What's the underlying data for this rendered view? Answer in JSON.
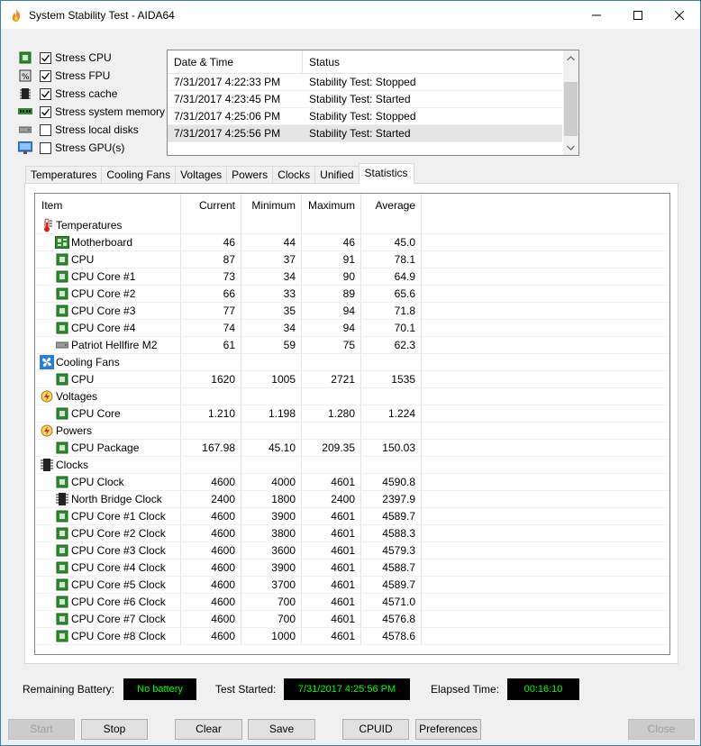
{
  "window": {
    "title": "System Stability Test - AIDA64"
  },
  "stress": [
    {
      "label": "Stress CPU",
      "checked": true,
      "icon": "cpu-chip-icon"
    },
    {
      "label": "Stress FPU",
      "checked": true,
      "icon": "fpu-icon"
    },
    {
      "label": "Stress cache",
      "checked": true,
      "icon": "cache-icon"
    },
    {
      "label": "Stress system memory",
      "checked": true,
      "icon": "memory-icon"
    },
    {
      "label": "Stress local disks",
      "checked": false,
      "icon": "disk-icon"
    },
    {
      "label": "Stress GPU(s)",
      "checked": false,
      "icon": "monitor-icon"
    }
  ],
  "log": {
    "headers": [
      "Date & Time",
      "Status"
    ],
    "rows": [
      {
        "time": "7/31/2017 4:22:33 PM",
        "status": "Stability Test: Stopped"
      },
      {
        "time": "7/31/2017 4:23:45 PM",
        "status": "Stability Test: Started"
      },
      {
        "time": "7/31/2017 4:25:06 PM",
        "status": "Stability Test: Stopped"
      },
      {
        "time": "7/31/2017 4:25:56 PM",
        "status": "Stability Test: Started"
      }
    ]
  },
  "tabs": [
    "Temperatures",
    "Cooling Fans",
    "Voltages",
    "Powers",
    "Clocks",
    "Unified",
    "Statistics"
  ],
  "active_tab": "Statistics",
  "stats": {
    "headers": {
      "item": "Item",
      "current": "Current",
      "minimum": "Minimum",
      "maximum": "Maximum",
      "average": "Average"
    },
    "rows": [
      {
        "type": "group",
        "icon": "thermometer-icon",
        "item": "Temperatures"
      },
      {
        "type": "child",
        "icon": "motherboard-icon",
        "item": "Motherboard",
        "current": "46",
        "minimum": "44",
        "maximum": "46",
        "average": "45.0"
      },
      {
        "type": "child",
        "icon": "cpu-chip-icon",
        "item": "CPU",
        "current": "87",
        "minimum": "37",
        "maximum": "91",
        "average": "78.1"
      },
      {
        "type": "child",
        "icon": "cpu-chip-icon",
        "item": "CPU Core #1",
        "current": "73",
        "minimum": "34",
        "maximum": "90",
        "average": "64.9"
      },
      {
        "type": "child",
        "icon": "cpu-chip-icon",
        "item": "CPU Core #2",
        "current": "66",
        "minimum": "33",
        "maximum": "89",
        "average": "65.6"
      },
      {
        "type": "child",
        "icon": "cpu-chip-icon",
        "item": "CPU Core #3",
        "current": "77",
        "minimum": "35",
        "maximum": "94",
        "average": "71.8"
      },
      {
        "type": "child",
        "icon": "cpu-chip-icon",
        "item": "CPU Core #4",
        "current": "74",
        "minimum": "34",
        "maximum": "94",
        "average": "70.1"
      },
      {
        "type": "child",
        "icon": "ssd-icon",
        "item": "Patriot Hellfire M2",
        "current": "61",
        "minimum": "59",
        "maximum": "75",
        "average": "62.3"
      },
      {
        "type": "group",
        "icon": "fan-icon",
        "item": "Cooling Fans"
      },
      {
        "type": "child",
        "icon": "cpu-chip-icon",
        "item": "CPU",
        "current": "1620",
        "minimum": "1005",
        "maximum": "2721",
        "average": "1535"
      },
      {
        "type": "group",
        "icon": "voltage-icon",
        "item": "Voltages"
      },
      {
        "type": "child",
        "icon": "cpu-chip-icon",
        "item": "CPU Core",
        "current": "1.210",
        "minimum": "1.198",
        "maximum": "1.280",
        "average": "1.224"
      },
      {
        "type": "group",
        "icon": "power-icon",
        "item": "Powers"
      },
      {
        "type": "child",
        "icon": "cpu-chip-icon",
        "item": "CPU Package",
        "current": "167.98",
        "minimum": "45.10",
        "maximum": "209.35",
        "average": "150.03"
      },
      {
        "type": "group",
        "icon": "clock-chip-icon",
        "item": "Clocks"
      },
      {
        "type": "child",
        "icon": "cpu-chip-icon",
        "item": "CPU Clock",
        "current": "4600",
        "minimum": "4000",
        "maximum": "4601",
        "average": "4590.8"
      },
      {
        "type": "child",
        "icon": "chipset-icon",
        "item": "North Bridge Clock",
        "current": "2400",
        "minimum": "1800",
        "maximum": "2400",
        "average": "2397.9"
      },
      {
        "type": "child",
        "icon": "cpu-chip-icon",
        "item": "CPU Core #1 Clock",
        "current": "4600",
        "minimum": "3900",
        "maximum": "4601",
        "average": "4589.7"
      },
      {
        "type": "child",
        "icon": "cpu-chip-icon",
        "item": "CPU Core #2 Clock",
        "current": "4600",
        "minimum": "3800",
        "maximum": "4601",
        "average": "4588.3"
      },
      {
        "type": "child",
        "icon": "cpu-chip-icon",
        "item": "CPU Core #3 Clock",
        "current": "4600",
        "minimum": "3600",
        "maximum": "4601",
        "average": "4579.3"
      },
      {
        "type": "child",
        "icon": "cpu-chip-icon",
        "item": "CPU Core #4 Clock",
        "current": "4600",
        "minimum": "3900",
        "maximum": "4601",
        "average": "4588.7"
      },
      {
        "type": "child",
        "icon": "cpu-chip-icon",
        "item": "CPU Core #5 Clock",
        "current": "4600",
        "minimum": "3700",
        "maximum": "4601",
        "average": "4589.7"
      },
      {
        "type": "child",
        "icon": "cpu-chip-icon",
        "item": "CPU Core #6 Clock",
        "current": "4600",
        "minimum": "700",
        "maximum": "4601",
        "average": "4571.0"
      },
      {
        "type": "child",
        "icon": "cpu-chip-icon",
        "item": "CPU Core #7 Clock",
        "current": "4600",
        "minimum": "700",
        "maximum": "4601",
        "average": "4576.8"
      },
      {
        "type": "child",
        "icon": "cpu-chip-icon",
        "item": "CPU Core #8 Clock",
        "current": "4600",
        "minimum": "1000",
        "maximum": "4601",
        "average": "4578.6"
      }
    ]
  },
  "status": {
    "battery_label": "Remaining Battery:",
    "battery_value": "No battery",
    "started_label": "Test Started:",
    "started_value": "7/31/2017 4:25:56 PM",
    "elapsed_label": "Elapsed Time:",
    "elapsed_value": "00:16:10",
    "display_color": "#00ff00"
  },
  "buttons": {
    "start": "Start",
    "stop": "Stop",
    "clear": "Clear",
    "save": "Save",
    "cpuid": "CPUID",
    "preferences": "Preferences",
    "close": "Close"
  },
  "colors": {
    "chip_green": "#2e8b2e",
    "display_bg": "#000000",
    "display_text": "#00ff00"
  }
}
